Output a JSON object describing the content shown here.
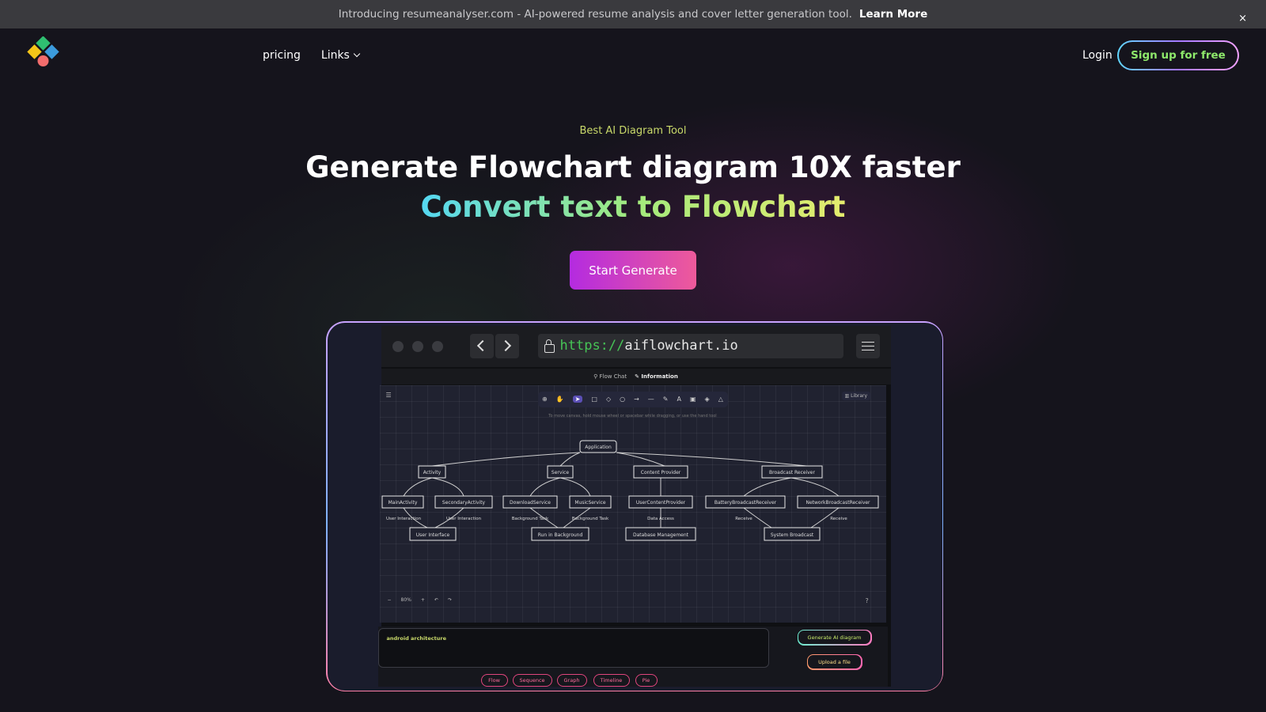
{
  "announcement": {
    "text": "Introducing resumeanalyser.com - AI-powered resume analysis and cover letter generation tool.",
    "link_label": "Learn More",
    "close_label": "×"
  },
  "nav": {
    "pricing_label": "pricing",
    "links_label": "Links",
    "login_label": "Login",
    "signup_label": "Sign up for free"
  },
  "hero": {
    "eyebrow": "Best AI Diagram Tool",
    "headline": "Generate Flowchart diagram 10X faster",
    "subline": "Convert text to Flowchart",
    "cta_label": "Start Generate"
  },
  "colors": {
    "background": "#15141c",
    "accent_gradient_start": "#b42be0",
    "accent_gradient_end": "#ee5a9a",
    "eyebrow": "#c9d96a"
  },
  "preview": {
    "url_protocol": "https://",
    "url_host": "aiflowchart.io",
    "tab_flow": "Flow Chat",
    "tab_info": "Information",
    "library_label": "Library",
    "hint": "To move canvas, hold mouse wheel or spacebar while dragging, or use the hand tool",
    "zoom_level": "80%",
    "prompt_text": "android architecture",
    "generate_label": "Generate AI diagram",
    "upload_label": "Upload a file",
    "chips": [
      "Flow",
      "Sequence",
      "Graph",
      "Timeline",
      "Pie"
    ],
    "diagram": {
      "root": "Application",
      "level1": [
        "Activity",
        "Service",
        "Content Provider",
        "Broadcast Receiver"
      ],
      "level2": [
        "MainActivity",
        "SecondaryActivity",
        "DownloadService",
        "MusicService",
        "UserContentProvider",
        "BatteryBroadcastReceiver",
        "NetworkBroadcastReceiver"
      ],
      "edge_labels": [
        "User Interaction",
        "User Interaction",
        "Background Task",
        "Background Task",
        "Data Access",
        "Receive",
        "Receive"
      ],
      "level3": [
        "User Interface",
        "Run in Background",
        "Database Management",
        "System Broadcast"
      ]
    }
  }
}
